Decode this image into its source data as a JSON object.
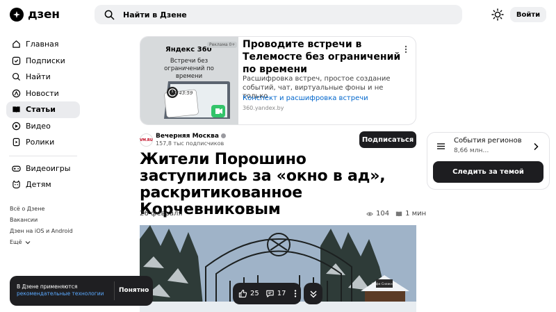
{
  "header": {
    "logo_text": "дзен",
    "search_placeholder": "Найти в Дзене",
    "login_label": "Войти"
  },
  "sidebar": {
    "items": [
      {
        "label": "Главная",
        "icon": "home-icon"
      },
      {
        "label": "Подписки",
        "icon": "subscriptions-icon"
      },
      {
        "label": "Найти",
        "icon": "search-icon"
      },
      {
        "label": "Новости",
        "icon": "news-icon"
      },
      {
        "label": "Статьи",
        "icon": "articles-icon",
        "active": true
      },
      {
        "label": "Видео",
        "icon": "video-icon"
      },
      {
        "label": "Ролики",
        "icon": "shorts-icon"
      },
      {
        "label": "Видеоигры",
        "icon": "gamepad-icon"
      },
      {
        "label": "Детям",
        "icon": "kids-icon"
      }
    ],
    "footer_links": [
      "Всё о Дзене",
      "Вакансии",
      "Дзен на iOS и Android",
      "Ещё"
    ]
  },
  "ad": {
    "brand": "Яндекс 360",
    "age": "Реклама 0+",
    "image_caption": "Встречи без ограничений по времени",
    "timer": "02:43:59",
    "title": "Проводите встречи в Телемосте без ограничений по времени",
    "description": "Расшифровка встреч, простое создание событий, чат, виртуальные фоны и не только",
    "link": "Конспект и расшифровка встречи",
    "domain": "360.yandex.by"
  },
  "article": {
    "publisher": "Вечерняя Москва",
    "publisher_logo": "VM.RU",
    "subscribers": "157,8 тыс подписчиков",
    "subscribe_label": "Подписаться",
    "title": "Жители Порошино заступились за «окно в ад», раскритикованное Корчевниковым",
    "date": "26 февраля",
    "views": "104",
    "read_time": "1 мин",
    "image_sign": "Кафе Снежный"
  },
  "topic": {
    "title": "События регионов",
    "subtitle": "8,66 млн…",
    "follow_label": "Следить за темой"
  },
  "cookie": {
    "text": "В Дзене применяются",
    "link": "рекомендательные технологии",
    "button": "Понятно"
  },
  "actions": {
    "likes": "25",
    "comments": "17"
  }
}
